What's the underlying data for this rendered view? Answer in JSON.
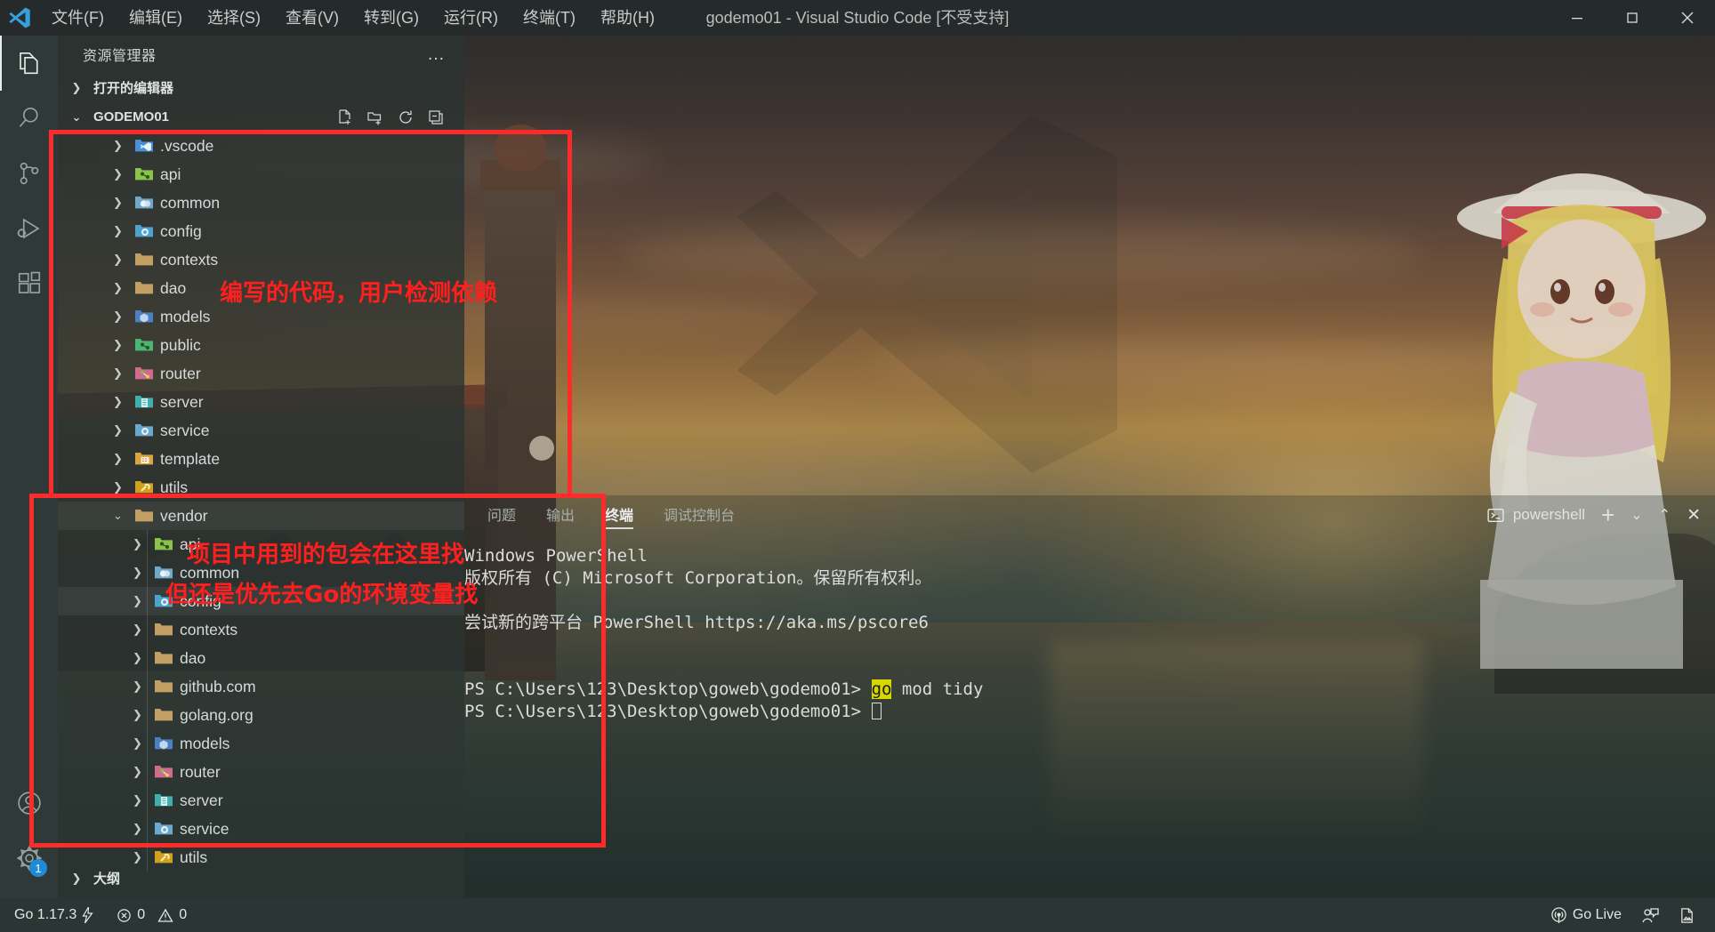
{
  "window": {
    "title": "godemo01 - Visual Studio Code [不受支持]",
    "minimize_label": "最小化",
    "maximize_label": "还原",
    "close_label": "关闭"
  },
  "menu": {
    "items": [
      {
        "label": "文件(F)",
        "name": "menu-file"
      },
      {
        "label": "编辑(E)",
        "name": "menu-edit"
      },
      {
        "label": "选择(S)",
        "name": "menu-selection"
      },
      {
        "label": "查看(V)",
        "name": "menu-view"
      },
      {
        "label": "转到(G)",
        "name": "menu-goto"
      },
      {
        "label": "运行(R)",
        "name": "menu-run"
      },
      {
        "label": "终端(T)",
        "name": "menu-terminal"
      },
      {
        "label": "帮助(H)",
        "name": "menu-help"
      }
    ]
  },
  "activity_bar": {
    "items": [
      {
        "icon": "files-icon",
        "label": "资源管理器",
        "active": true
      },
      {
        "icon": "search-icon",
        "label": "搜索",
        "active": false
      },
      {
        "icon": "source-control-icon",
        "label": "源代码管理",
        "active": false
      },
      {
        "icon": "run-debug-icon",
        "label": "运行和调试",
        "active": false
      },
      {
        "icon": "extensions-icon",
        "label": "扩展",
        "active": false
      }
    ],
    "bottom": [
      {
        "icon": "account-icon",
        "label": "账户",
        "badge": ""
      },
      {
        "icon": "gear-icon",
        "label": "管理",
        "badge": "1"
      }
    ]
  },
  "sidebar": {
    "title": "资源管理器",
    "more_actions": "…",
    "open_editors": {
      "label": "打开的编辑器",
      "expanded": false
    },
    "outline": {
      "label": "大纲",
      "expanded": false
    },
    "workspace": {
      "label": "GODEMO01",
      "expanded": true,
      "actions": [
        {
          "name": "new-file-icon",
          "title": "新建文件"
        },
        {
          "name": "new-folder-icon",
          "title": "新建文件夹"
        },
        {
          "name": "refresh-icon",
          "title": "在资源管理器中刷新"
        },
        {
          "name": "collapse-all-icon",
          "title": "在资源管理器中折叠文件夹"
        }
      ]
    },
    "tree": [
      {
        "label": ".vscode",
        "icon": "vscode-folder-icon",
        "color": "#4a90d9",
        "indent": 1,
        "expanded": false
      },
      {
        "label": "api",
        "icon": "api-folder-icon",
        "color": "#8bc34a",
        "indent": 1,
        "expanded": false
      },
      {
        "label": "common",
        "icon": "common-folder-icon",
        "color": "#6fa8c8",
        "indent": 1,
        "expanded": false
      },
      {
        "label": "config",
        "icon": "config-folder-icon",
        "color": "#4da3cf",
        "indent": 1,
        "expanded": false
      },
      {
        "label": "contexts",
        "icon": "folder-icon",
        "color": "#c2a063",
        "indent": 1,
        "expanded": false
      },
      {
        "label": "dao",
        "icon": "folder-icon",
        "color": "#c2a063",
        "indent": 1,
        "expanded": false
      },
      {
        "label": "models",
        "icon": "models-folder-icon",
        "color": "#4a7fc1",
        "indent": 1,
        "expanded": false
      },
      {
        "label": "public",
        "icon": "public-folder-icon",
        "color": "#49b675",
        "indent": 1,
        "expanded": false
      },
      {
        "label": "router",
        "icon": "router-folder-icon",
        "color": "#d06b8c",
        "indent": 1,
        "expanded": false
      },
      {
        "label": "server",
        "icon": "server-folder-icon",
        "color": "#3fb0ad",
        "indent": 1,
        "expanded": false
      },
      {
        "label": "service",
        "icon": "service-folder-icon",
        "color": "#6aa9cf",
        "indent": 1,
        "expanded": false
      },
      {
        "label": "template",
        "icon": "template-folder-icon",
        "color": "#d9a441",
        "indent": 1,
        "expanded": false
      },
      {
        "label": "utils",
        "icon": "utils-folder-icon",
        "color": "#d0a01e",
        "indent": 1,
        "expanded": false
      },
      {
        "label": "vendor",
        "icon": "folder-icon",
        "color": "#c2a063",
        "indent": 1,
        "expanded": true,
        "highlight": true
      },
      {
        "label": "api",
        "icon": "api-folder-icon",
        "color": "#8bc34a",
        "indent": 2,
        "expanded": false
      },
      {
        "label": "common",
        "icon": "common-folder-icon",
        "color": "#6fa8c8",
        "indent": 2,
        "expanded": false
      },
      {
        "label": "config",
        "icon": "config-folder-icon",
        "color": "#4da3cf",
        "indent": 2,
        "expanded": false,
        "highlight": true
      },
      {
        "label": "contexts",
        "icon": "folder-icon",
        "color": "#c2a063",
        "indent": 2,
        "expanded": false
      },
      {
        "label": "dao",
        "icon": "folder-icon",
        "color": "#c2a063",
        "indent": 2,
        "expanded": false
      },
      {
        "label": "github.com",
        "icon": "folder-icon",
        "color": "#c2a063",
        "indent": 2,
        "expanded": false
      },
      {
        "label": "golang.org",
        "icon": "folder-icon",
        "color": "#c2a063",
        "indent": 2,
        "expanded": false
      },
      {
        "label": "models",
        "icon": "models-folder-icon",
        "color": "#4a7fc1",
        "indent": 2,
        "expanded": false
      },
      {
        "label": "router",
        "icon": "router-folder-icon",
        "color": "#d06b8c",
        "indent": 2,
        "expanded": false
      },
      {
        "label": "server",
        "icon": "server-folder-icon",
        "color": "#3fb0ad",
        "indent": 2,
        "expanded": false
      },
      {
        "label": "service",
        "icon": "service-folder-icon",
        "color": "#6aa9cf",
        "indent": 2,
        "expanded": false
      },
      {
        "label": "utils",
        "icon": "utils-folder-icon",
        "color": "#d0a01e",
        "indent": 2,
        "expanded": false
      }
    ]
  },
  "panel": {
    "tabs": [
      {
        "label": "问题",
        "active": false
      },
      {
        "label": "输出",
        "active": false
      },
      {
        "label": "终端",
        "active": true
      },
      {
        "label": "调试控制台",
        "active": false
      }
    ],
    "shell_name": "powershell",
    "actions": [
      {
        "name": "new-terminal-icon",
        "label": "+"
      },
      {
        "name": "chevron-down-icon",
        "label": "⌄"
      },
      {
        "name": "maximize-panel-icon",
        "label": "⌃"
      },
      {
        "name": "close-panel-icon",
        "label": "✕"
      }
    ],
    "terminal": {
      "lines": [
        {
          "text": "Windows PowerShell",
          "type": "plain"
        },
        {
          "text": "版权所有 (C) Microsoft Corporation。保留所有权利。",
          "type": "plain"
        },
        {
          "text": "",
          "type": "plain"
        },
        {
          "text": "尝试新的跨平台 PowerShell https://aka.ms/pscore6",
          "type": "plain"
        },
        {
          "text": "",
          "type": "plain"
        },
        {
          "text": "",
          "type": "plain"
        }
      ],
      "prompt": "PS C:\\Users\\123\\Desktop\\goweb\\godemo01>",
      "command_keyword": "go",
      "command_rest": " mod tidy"
    }
  },
  "status_bar": {
    "left": [
      {
        "name": "go-version",
        "label": "Go 1.17.3",
        "icon": "lightning-icon"
      },
      {
        "name": "problems",
        "errors": "0",
        "warnings": "0",
        "error_icon": "error-circle-icon",
        "warning_icon": "warning-triangle-icon"
      }
    ],
    "right": [
      {
        "name": "go-live",
        "label": "Go Live",
        "icon": "broadcast-icon"
      },
      {
        "name": "feedback",
        "label": "",
        "icon": "feedback-icon"
      },
      {
        "name": "screenshot",
        "label": "",
        "icon": "screenshot-icon"
      }
    ]
  },
  "annotations": {
    "note1": "编写的代码，用户检测依赖",
    "note2_line1": "项目中用到的包会在这里找",
    "note2_line2": "但还是优先去Go的环境变量找",
    "color": "#ff1f1f"
  }
}
